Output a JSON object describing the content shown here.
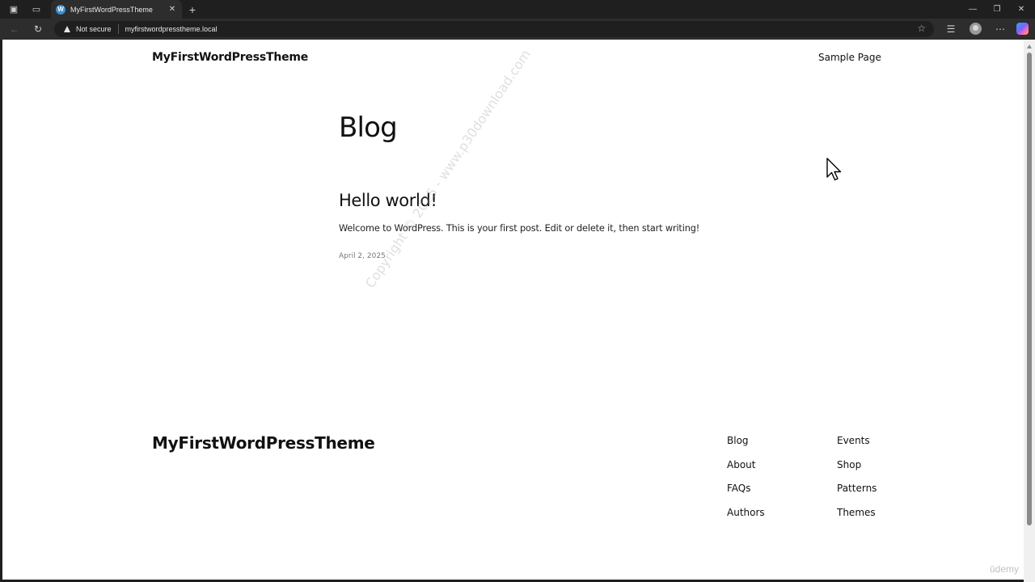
{
  "browser": {
    "tab": {
      "title": "MyFirstWordPressTheme",
      "favicon": "wordpress-icon"
    },
    "address": {
      "security_label": "Not secure",
      "url": "myfirstwordpresstheme.local"
    }
  },
  "site": {
    "title": "MyFirstWordPressTheme",
    "header_nav": [
      "Sample Page"
    ]
  },
  "main": {
    "page_title": "Blog",
    "posts": [
      {
        "title": "Hello world!",
        "excerpt": "Welcome to WordPress. This is your first post. Edit or delete it, then start writing!",
        "date": "April 2, 2025"
      }
    ]
  },
  "footer": {
    "title": "MyFirstWordPressTheme",
    "nav_col1": [
      "Blog",
      "About",
      "FAQs",
      "Authors"
    ],
    "nav_col2": [
      "Events",
      "Shop",
      "Patterns",
      "Themes"
    ]
  },
  "overlay": {
    "watermark": "Copyright © 2025 - www.p30download.com",
    "udemy": "ūdemy"
  },
  "colors": {
    "browser_bg": "#1f1f1f",
    "toolbar_bg": "#2d2d2d",
    "page_bg": "#ffffff",
    "text": "#111111",
    "date_text": "#777777"
  }
}
